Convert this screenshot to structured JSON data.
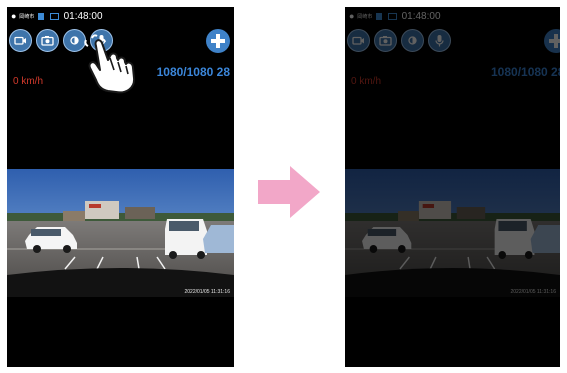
{
  "left_screen": {
    "status": {
      "pin_icon": "location-pin-icon",
      "area_text": "岡崎市",
      "time": "01:48:00"
    },
    "toolbar": [
      {
        "icon": "video-camera-icon"
      },
      {
        "icon": "photo-camera-icon"
      },
      {
        "icon": "dimmer-icon"
      },
      {
        "icon": "microphone-icon"
      }
    ],
    "add_button_icon": "plus-circle-icon",
    "speed": "0 km/h",
    "resolution": "1080/1080 28",
    "video": {
      "timestamp": "2022/01/05 11:31:16"
    },
    "gesture_icon": "tap-hand-icon"
  },
  "right_screen": {
    "status": {
      "area_text": "岡崎市",
      "time": "01:48:00"
    },
    "speed": "0 km/h",
    "resolution": "1080/1080 28",
    "video": {
      "timestamp": "2022/01/05 11:31:16"
    },
    "dimmed": true
  },
  "transition_arrow_color": "#f2a7c8",
  "colors": {
    "accent_blue": "#3b86d9",
    "speed_red": "#d33a2c",
    "button_blue": "#3e74aa"
  }
}
